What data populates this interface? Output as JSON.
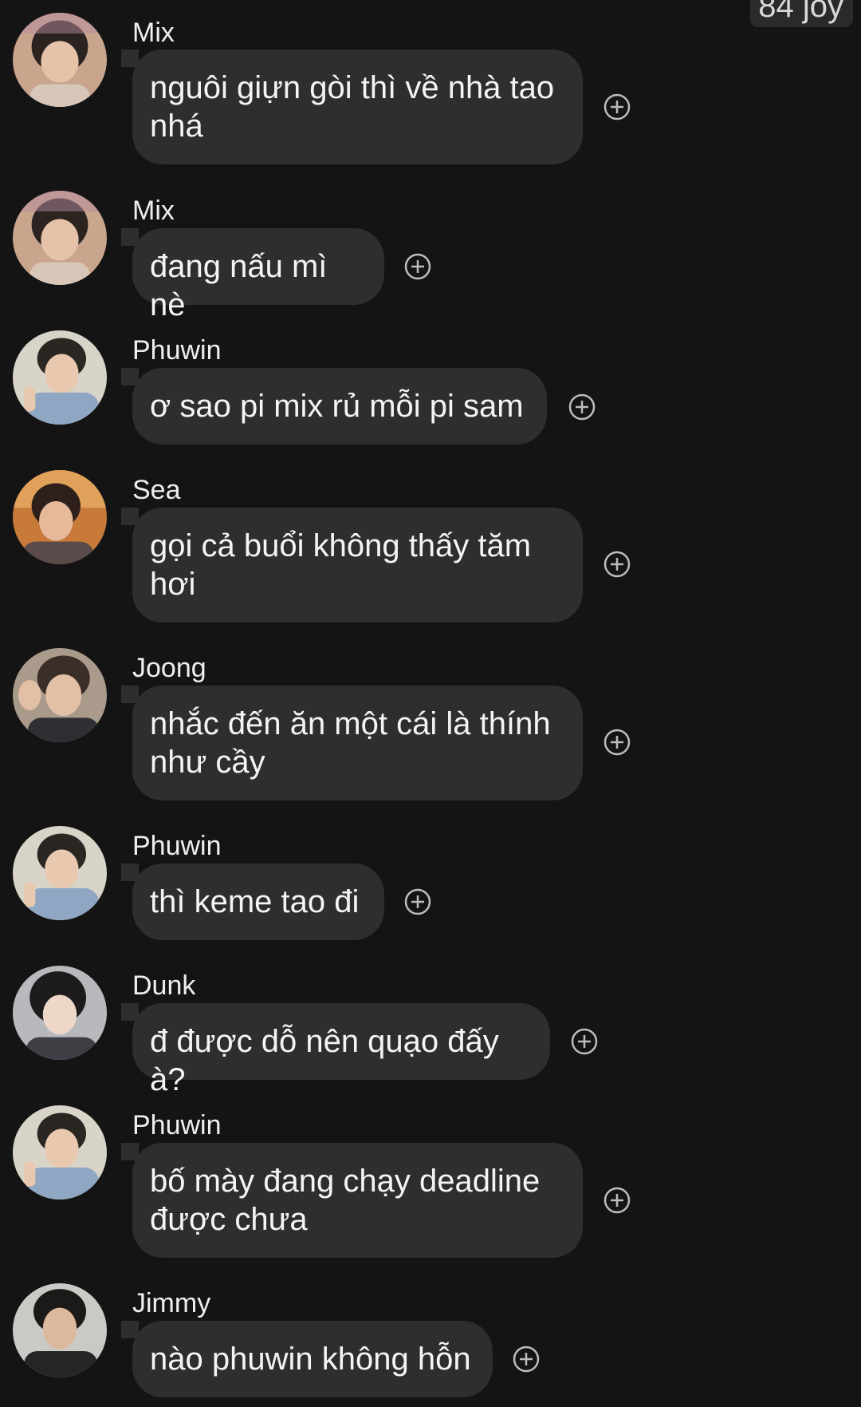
{
  "header": {
    "badge_text": "84 joy"
  },
  "messages": [
    {
      "sender": "Mix",
      "text": "nguôi giựn gòi thì về nhà tao nhá",
      "avatar": "mix-avatar"
    },
    {
      "sender": "Mix",
      "text": "đang nấu mì nè",
      "avatar": "mix-avatar"
    },
    {
      "sender": "Phuwin",
      "text": "ơ sao pi mix rủ mỗi pi sam",
      "avatar": "phuwin-avatar"
    },
    {
      "sender": "Sea",
      "text": "gọi cả buổi không thấy tăm hơi",
      "avatar": "sea-avatar"
    },
    {
      "sender": "Joong",
      "text": "nhắc đến ăn một cái là thính như cầy",
      "avatar": "joong-avatar"
    },
    {
      "sender": "Phuwin",
      "text": "thì keme tao đi",
      "avatar": "phuwin-avatar"
    },
    {
      "sender": "Dunk",
      "text": "đ được dỗ nên quạo đấy à?",
      "avatar": "dunk-avatar"
    },
    {
      "sender": "Phuwin",
      "text": "bố mày đang chạy deadline được chưa",
      "avatar": "phuwin-avatar"
    },
    {
      "sender": "Jimmy",
      "text": "nào phuwin không hỗn",
      "avatar": "jimmy-avatar"
    }
  ],
  "colors": {
    "background": "#141414",
    "bubble": "#2e2e2e",
    "text": "#f4f4f4",
    "react_icon": "#bdbdbd"
  },
  "icons": {
    "react": "add-reaction-icon"
  }
}
